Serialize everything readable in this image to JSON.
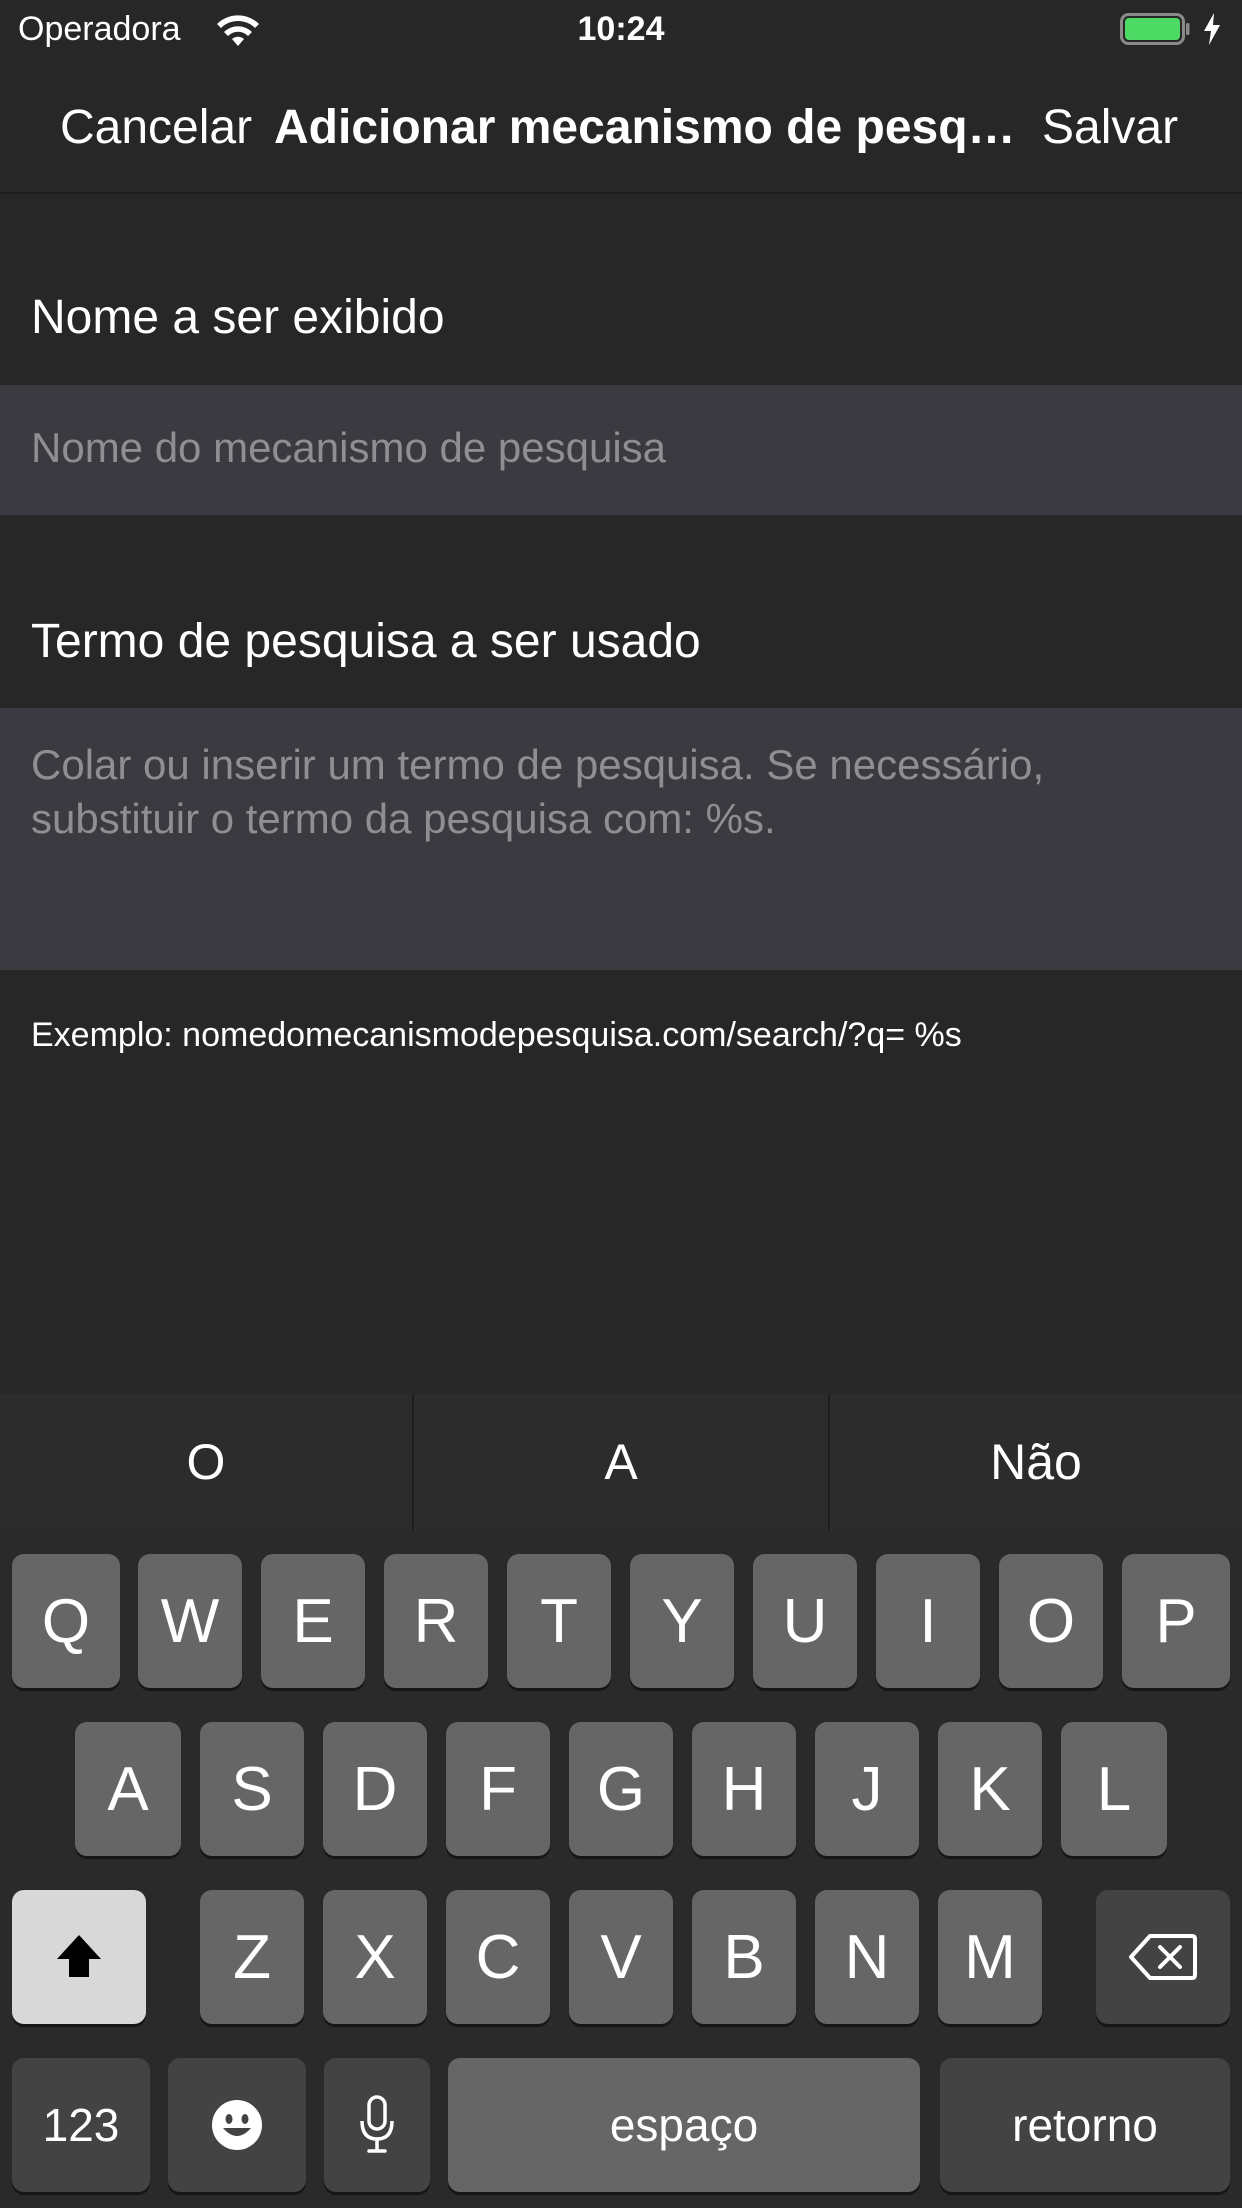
{
  "status_bar": {
    "carrier": "Operadora",
    "time": "10:24",
    "wifi_icon": "wifi-icon",
    "battery_icon": "battery-full-icon",
    "battery_color": "#4cd964",
    "charging_icon": "charging-bolt-icon"
  },
  "nav": {
    "cancel_label": "Cancelar",
    "title": "Adicionar mecanismo de pesquisa",
    "save_label": "Salvar"
  },
  "form": {
    "name_label": "Nome a ser exibido",
    "name_placeholder": "Nome do mecanismo de pesquisa",
    "term_label": "Termo de pesquisa a ser usado",
    "term_placeholder": "Colar ou inserir um termo de pesquisa. Se necessário, substituir o termo da pesquisa com: %s.",
    "example": "Exemplo: nomedomecanismodepesquisa.com/search/?q= %s"
  },
  "predictive": {
    "suggestions": [
      "O",
      "A",
      "Não"
    ]
  },
  "keyboard": {
    "row1": [
      "Q",
      "W",
      "E",
      "R",
      "T",
      "Y",
      "U",
      "I",
      "O",
      "P"
    ],
    "row2": [
      "A",
      "S",
      "D",
      "F",
      "G",
      "H",
      "J",
      "K",
      "L"
    ],
    "row3": [
      "Z",
      "X",
      "C",
      "V",
      "B",
      "N",
      "M"
    ],
    "numbers_label": "123",
    "space_label": "espaço",
    "return_label": "retorno",
    "shift_icon": "shift-icon",
    "delete_icon": "delete-backspace-icon",
    "emoji_icon": "emoji-icon",
    "mic_icon": "microphone-icon"
  }
}
